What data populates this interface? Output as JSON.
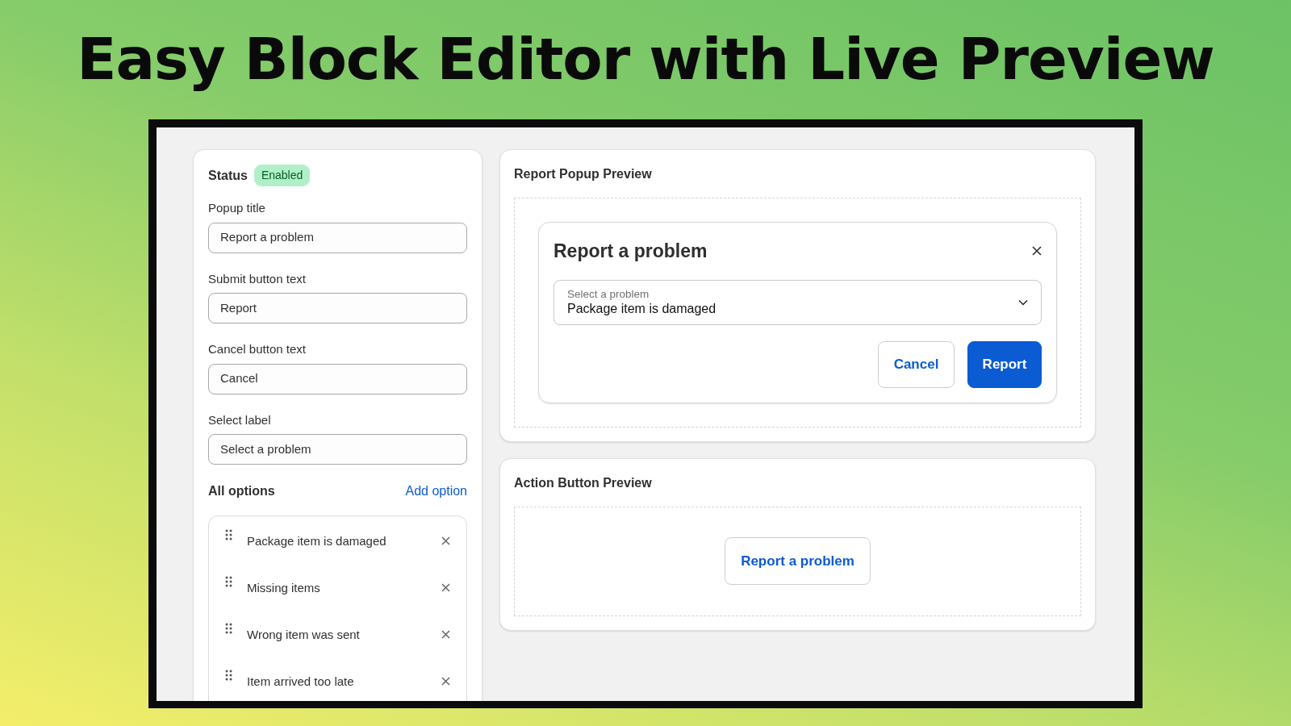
{
  "headline": "Easy Block Editor with Live Preview",
  "settings": {
    "status_label": "Status",
    "status_badge": "Enabled",
    "fields": [
      {
        "label": "Popup title",
        "value": "Report a problem"
      },
      {
        "label": "Submit button text",
        "value": "Report"
      },
      {
        "label": "Cancel button text",
        "value": "Cancel"
      },
      {
        "label": "Select label",
        "value": "Select a problem"
      }
    ],
    "options_title": "All options",
    "add_option": "Add option",
    "options": [
      "Package item is damaged",
      "Missing items",
      "Wrong item was sent",
      "Item arrived too late"
    ]
  },
  "popup_preview": {
    "title": "Report Popup Preview",
    "popup": {
      "heading": "Report a problem",
      "select_label": "Select a problem",
      "select_value": "Package item is damaged",
      "cancel": "Cancel",
      "submit": "Report"
    }
  },
  "action_preview": {
    "title": "Action Button Preview",
    "button": "Report a problem"
  }
}
